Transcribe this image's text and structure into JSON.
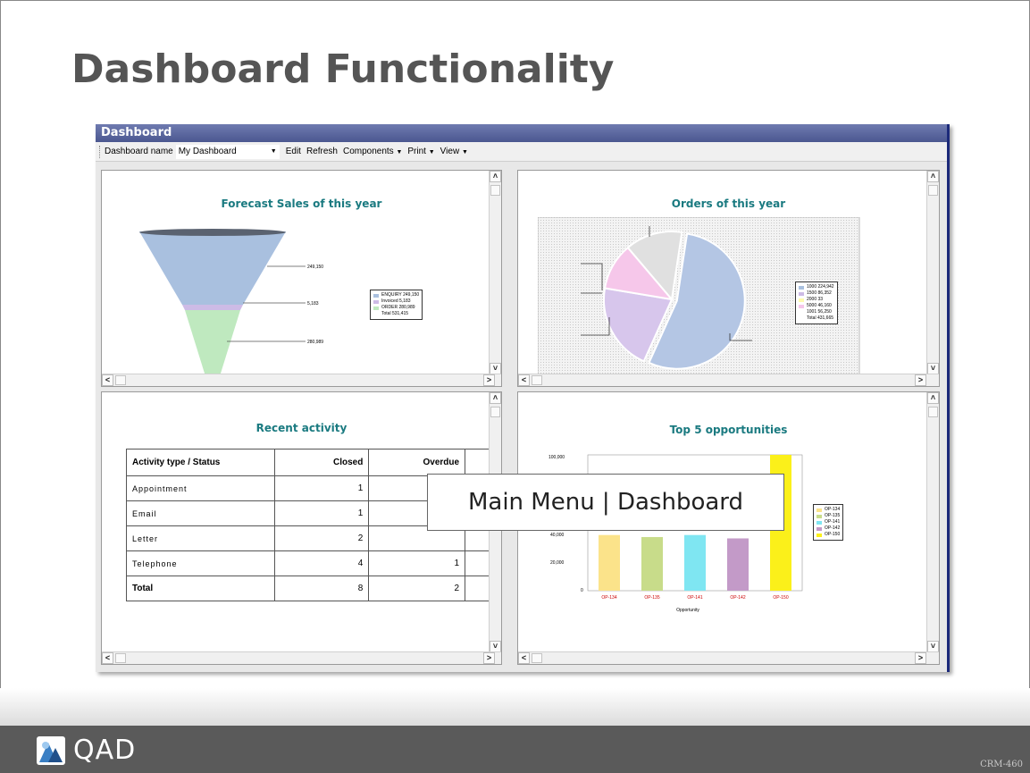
{
  "slide": {
    "title": "Dashboard Functionality",
    "overlay_label": "Main Menu | Dashboard",
    "footer_logo_text": "QAD",
    "course_code": "CRM-460"
  },
  "window": {
    "title": "Dashboard",
    "toolbar": {
      "name_label": "Dashboard name",
      "name_value": "My Dashboard",
      "edit": "Edit",
      "refresh": "Refresh",
      "components": "Components",
      "print": "Print",
      "view": "View"
    }
  },
  "panes": {
    "forecast": {
      "title": "Forecast Sales of this year",
      "funnel_labels": [
        "249,150",
        "5,183",
        "280,989"
      ],
      "legend": [
        {
          "name": "ENQUIRY",
          "value": "249,150",
          "color": "#a9c0df"
        },
        {
          "name": "Invoiced",
          "value": "5,183",
          "color": "#cdbbe6"
        },
        {
          "name": "ORDER",
          "value": "280,989",
          "color": "#bfe9bf"
        },
        {
          "name": "Total",
          "value": "531,415",
          "color": "#ffffff"
        }
      ]
    },
    "orders": {
      "title": "Orders of this year",
      "legend": [
        {
          "name": "1000",
          "value": "224,942",
          "color": "#a9c0df"
        },
        {
          "name": "1500",
          "value": "86,352",
          "color": "#cdbbe6"
        },
        {
          "name": "2000",
          "value": "33",
          "color": "#fffbb0"
        },
        {
          "name": "5000",
          "value": "46,160",
          "color": "#f6c7ea"
        },
        {
          "name": "1001",
          "value": "56,250",
          "color": "#ffffff"
        },
        {
          "name": "Total",
          "value": "431,665",
          "color": "#ffffff"
        }
      ]
    },
    "activity": {
      "title": "Recent activity",
      "columns": [
        "Activity type / Status",
        "Closed",
        "Overdue"
      ],
      "rows": [
        {
          "label": "Appointment",
          "closed": "1",
          "overdue": ""
        },
        {
          "label": "Email",
          "closed": "1",
          "overdue": ""
        },
        {
          "label": "Letter",
          "closed": "2",
          "overdue": ""
        },
        {
          "label": "Telephone",
          "closed": "4",
          "overdue": "1"
        },
        {
          "label": "Total",
          "closed": "8",
          "overdue": "2"
        }
      ]
    },
    "opportunities": {
      "title": "Top 5 opportunities",
      "xlabel": "Opportunity",
      "ytick_labels": [
        "100,000",
        "40,000",
        "20,000",
        "0"
      ],
      "legend": [
        "OP-134",
        "OP-135",
        "OP-141",
        "OP-142",
        "OP-150"
      ]
    }
  },
  "chart_data": [
    {
      "type": "bar",
      "title": "Top 5 opportunities",
      "xlabel": "Opportunity",
      "categories": [
        "OP-134",
        "OP-135",
        "OP-141",
        "OP-142",
        "OP-150"
      ],
      "values": [
        41000,
        39500,
        41000,
        38500,
        100000
      ],
      "colors": [
        "#fbe38a",
        "#c8dc8a",
        "#7fe6f2",
        "#c39ac8",
        "#fbf01a"
      ],
      "ylim": [
        0,
        100000
      ]
    },
    {
      "type": "pie",
      "title": "Orders of this year",
      "categories": [
        "1000",
        "1500",
        "2000",
        "5000",
        "1001"
      ],
      "values": [
        224942,
        86352,
        33,
        46160,
        56250
      ],
      "colors": [
        "#b4c6e4",
        "#d7c6ec",
        "#fffbb0",
        "#f6c7ea",
        "#e0e0e0"
      ]
    }
  ]
}
